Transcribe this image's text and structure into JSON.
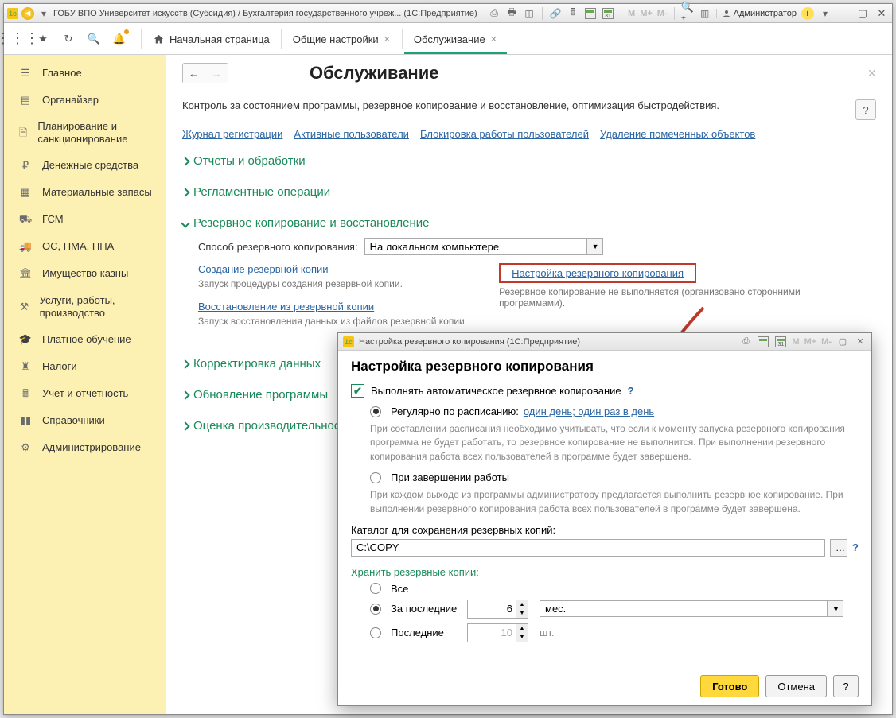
{
  "titlebar": {
    "app_title": "ГОБУ ВПО Университет искусств (Субсидия) / Бухгалтерия государственного учреж... (1С:Предприятие)",
    "user": "Администратор",
    "m_labels": [
      "M",
      "M+",
      "M-"
    ]
  },
  "topbar": {
    "start_tab": "Начальная страница",
    "tab_settings": "Общие настройки",
    "tab_maint": "Обслуживание"
  },
  "sidebar": {
    "items": [
      {
        "label": "Главное",
        "icon": "menu"
      },
      {
        "label": "Органайзер",
        "icon": "cal"
      },
      {
        "label": "Планирование и санкционирование",
        "icon": "doc"
      },
      {
        "label": "Денежные средства",
        "icon": "ruble"
      },
      {
        "label": "Материальные запасы",
        "icon": "boxes"
      },
      {
        "label": "ГСМ",
        "icon": "truck"
      },
      {
        "label": "ОС, НМА, НПА",
        "icon": "truck2"
      },
      {
        "label": "Имущество казны",
        "icon": "building"
      },
      {
        "label": "Услуги, работы, производство",
        "icon": "gears"
      },
      {
        "label": "Платное обучение",
        "icon": "grad"
      },
      {
        "label": "Налоги",
        "icon": "eagle"
      },
      {
        "label": "Учет и отчетность",
        "icon": "calc"
      },
      {
        "label": "Справочники",
        "icon": "books"
      },
      {
        "label": "Администрирование",
        "icon": "cog"
      }
    ]
  },
  "page": {
    "title": "Обслуживание",
    "subtitle": "Контроль за состоянием программы, резервное копирование и восстановление, оптимизация быстродействия.",
    "links": [
      "Журнал регистрации",
      "Активные пользователи",
      "Блокировка работы пользователей",
      "Удаление помеченных объектов"
    ]
  },
  "sections": {
    "reports": "Отчеты и обработки",
    "reglament": "Регламентные операции",
    "backup": "Резервное копирование и восстановление",
    "corr": "Корректировка данных",
    "update": "Обновление программы",
    "perf": "Оценка производительности"
  },
  "backup": {
    "method_label": "Способ резервного копирования:",
    "method_value": "На локальном компьютере",
    "create_link": "Создание резервной копии",
    "create_desc": "Запуск процедуры создания резервной копии.",
    "restore_link": "Восстановление из резервной копии",
    "restore_desc": "Запуск восстановления данных из файлов резервной копии.",
    "settings_link": "Настройка резервного копирования",
    "settings_desc": "Резервное копирование не выполняется (организовано сторонними программами)."
  },
  "dialog": {
    "tb_title": "Настройка резервного копирования  (1С:Предприятие)",
    "title": "Настройка резервного копирования",
    "chk_label": "Выполнять автоматическое резервное копирование",
    "opt_schedule": "Регулярно по расписанию:",
    "schedule_link": "один день; один раз в день",
    "hint1": "При составлении расписания необходимо учитывать, что если к моменту запуска резервного копирования программа не будет работать, то резервное копирование не выполнится. При выполнении резервного копирования работа всех пользователей в программе будет завершена.",
    "opt_exit": "При завершении работы",
    "hint2": "При каждом выходе из программы администратору предлагается выполнить резервное копирование. При выполнении резервного копирования работа всех пользователей в программе будет завершена.",
    "cat_label": "Каталог для сохранения резервных копий:",
    "cat_value": "C:\\COPY",
    "keep_head": "Хранить резервные копии:",
    "keep_all": "Все",
    "keep_last": "За последние",
    "keep_last_val": "6",
    "keep_unit": "мес.",
    "keep_lastn": "Последние",
    "keep_lastn_val": "10",
    "keep_lastn_unit": "шт.",
    "btn_ok": "Готово",
    "btn_cancel": "Отмена",
    "m_labels": [
      "M",
      "M+",
      "M-"
    ]
  }
}
